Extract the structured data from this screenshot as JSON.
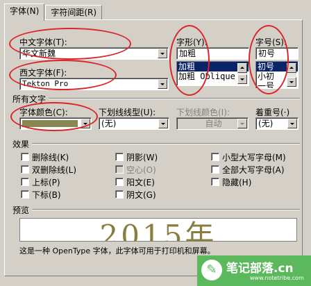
{
  "tabs": [
    "字体(N)",
    "字符间距(R)"
  ],
  "cn_font": {
    "label": "中文字体(T):",
    "value": "华文新魏"
  },
  "style": {
    "label": "字形(Y):",
    "value": "加粗",
    "items": [
      "加粗",
      "加粗 Oblique"
    ],
    "selected_index": 0
  },
  "size": {
    "label": "字号(S):",
    "value": "初号",
    "items": [
      "初号",
      "小初",
      "一号"
    ],
    "selected_index": 0
  },
  "west_font": {
    "label": "西文字体(F):",
    "value": "Tekton Pro"
  },
  "all_text": {
    "heading": "所有文字",
    "font_color": {
      "label": "字体颜色(C):",
      "swatch": "#8a8752"
    },
    "underline_style": {
      "label": "下划线线型(U):",
      "value": "(无)"
    },
    "underline_color": {
      "label": "下划线颜色(I):",
      "value": "自动"
    },
    "emphasis": {
      "label": "着重号(·)",
      "value": "(无)"
    }
  },
  "effects": {
    "heading": "效果",
    "col1": [
      {
        "label": "删除线(K)",
        "disabled": false
      },
      {
        "label": "双删除线(L)",
        "disabled": false
      },
      {
        "label": "上标(P)",
        "disabled": false
      },
      {
        "label": "下标(B)",
        "disabled": false
      }
    ],
    "col2": [
      {
        "label": "阴影(W)",
        "disabled": false
      },
      {
        "label": "空心(O)",
        "disabled": true
      },
      {
        "label": "阳文(E)",
        "disabled": false
      },
      {
        "label": "阴文(G)",
        "disabled": false
      }
    ],
    "col3": [
      {
        "label": "小型大写字母(M)",
        "disabled": false
      },
      {
        "label": "全部大写字母(A)",
        "disabled": false
      },
      {
        "label": "隐藏(H)",
        "disabled": false
      }
    ]
  },
  "preview": {
    "heading": "预览",
    "sample": "2015年",
    "note": "这是一种 OpenType 字体，此字体可用于打印机和屏幕。"
  },
  "watermark": {
    "title": "笔记部落.cn",
    "url": "www.notetribe.com",
    "icon": "pencil-icon"
  },
  "annotation_color": "#d9262b"
}
